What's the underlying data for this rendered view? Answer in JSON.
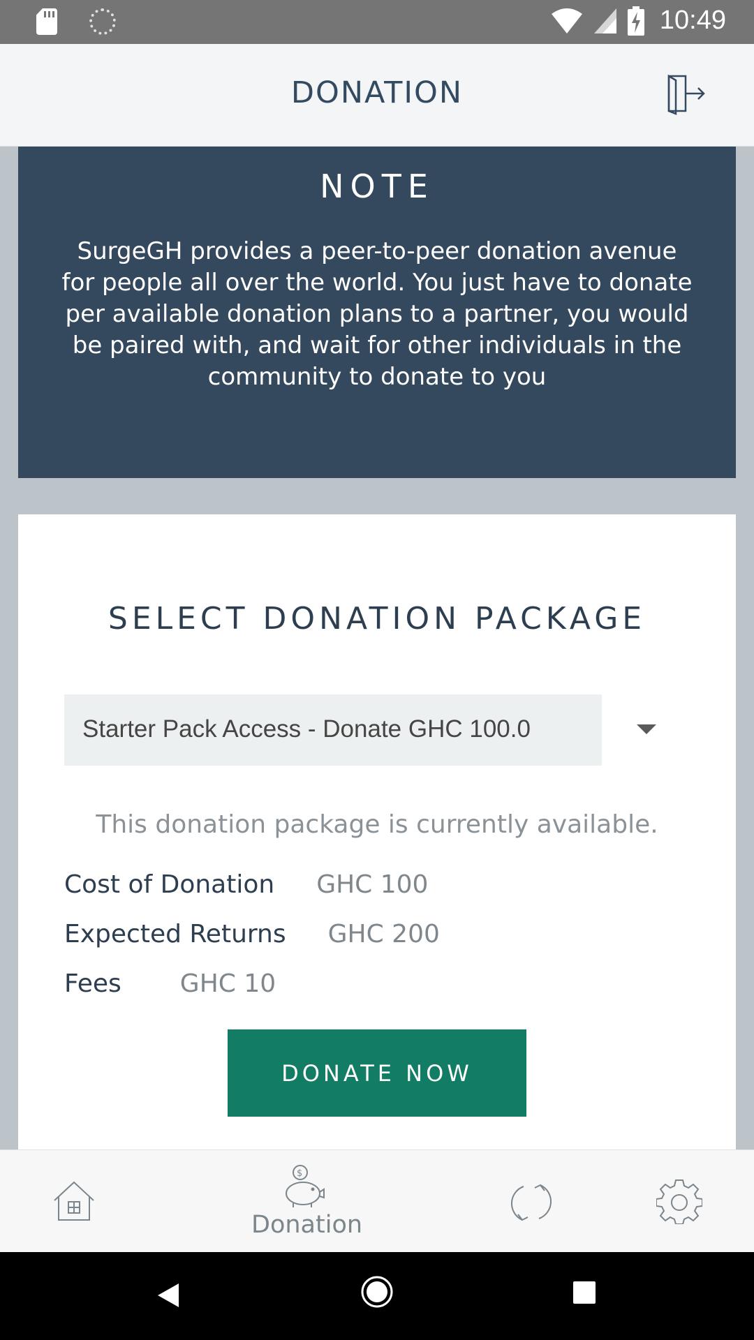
{
  "status_bar": {
    "time": "10:49"
  },
  "header": {
    "title": "DONATION"
  },
  "note": {
    "title": "NOTE",
    "body": "SurgeGH provides a peer-to-peer donation avenue for people all over the world. You just have to donate per available donation plans to a partner, you would be paired with, and wait for other individuals in the community to donate to you"
  },
  "package": {
    "title": "SELECT DONATION PACKAGE",
    "selected_option": "Starter Pack Access - Donate GHC 100.0",
    "availability": "This donation package is currently available.",
    "details": [
      {
        "label": "Cost of Donation",
        "value": "GHC 100"
      },
      {
        "label": "Expected Returns",
        "value": "GHC 200"
      },
      {
        "label": "Fees",
        "value": "GHC 10"
      }
    ],
    "donate_button": "DONATE NOW"
  },
  "bottom_nav": {
    "active_label": "Donation"
  },
  "colors": {
    "header_text": "#344a60",
    "note_background": "#35495e",
    "button_green": "#127d64",
    "page_background": "#bcc3c9"
  },
  "icons": {
    "status_left": [
      "sd-card-icon",
      "spinner-icon"
    ],
    "status_right": [
      "wifi-icon",
      "signal-icon",
      "battery-charging-icon"
    ],
    "header": "logout-icon",
    "nav": [
      "home-icon",
      "piggy-bank-icon",
      "refresh-icon",
      "settings-icon"
    ],
    "system": [
      "back-icon",
      "home-button-icon",
      "recents-icon"
    ]
  }
}
